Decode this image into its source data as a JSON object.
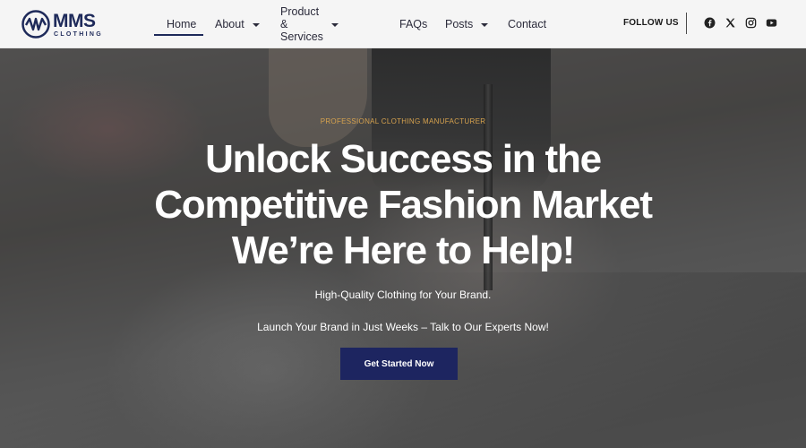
{
  "brand": {
    "name": "MMS",
    "tagline": "CLOTHING"
  },
  "nav": {
    "items": [
      {
        "label": "Home",
        "active": true,
        "dropdown": false
      },
      {
        "label": "About",
        "active": false,
        "dropdown": true
      },
      {
        "label": "Product & Services",
        "active": false,
        "dropdown": true
      },
      {
        "label": "FAQs",
        "active": false,
        "dropdown": false
      },
      {
        "label": "Posts",
        "active": false,
        "dropdown": true
      },
      {
        "label": "Contact",
        "active": false,
        "dropdown": false
      }
    ]
  },
  "follow": {
    "label": "FOLLOW US",
    "socials": [
      {
        "icon": "facebook-icon"
      },
      {
        "icon": "x-twitter-icon"
      },
      {
        "icon": "instagram-icon"
      },
      {
        "icon": "youtube-icon"
      }
    ]
  },
  "hero": {
    "eyebrow": "PROFESSIONAL CLOTHING MANUFACTURER",
    "headline": [
      "Unlock Success in the",
      "Competitive Fashion Market",
      "We’re Here to Help!"
    ],
    "subtitle": "High-Quality Clothing for Your Brand.",
    "subtitle2": "Launch Your Brand in Just Weeks – Talk to Our Experts Now!",
    "cta_label": "Get Started Now"
  },
  "colors": {
    "brand_navy": "#1e2a5a",
    "cta_bg": "#1d2560",
    "eyebrow_gold": "#d6a24e",
    "header_bg": "#f5f5f5"
  }
}
